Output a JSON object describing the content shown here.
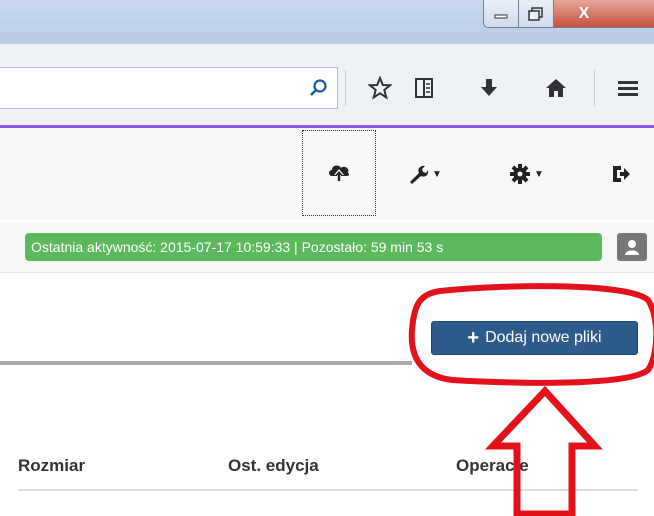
{
  "window": {
    "title_bar_buttons": [
      "minimize-button",
      "maximize-button",
      "close-button"
    ],
    "close_glyph": "X"
  },
  "browser_toolbar": {
    "icons": [
      "search-icon",
      "bookmark-star-icon",
      "reading-list-icon",
      "download-icon",
      "home-icon",
      "menu-icon"
    ]
  },
  "navbar": {
    "icons": [
      "cloud-upload-icon",
      "wrench-icon",
      "gear-icon",
      "logout-icon"
    ]
  },
  "status": {
    "text": "Ostatnia aktywność: 2015-07-17 10:59:33 | Pozostało: 59 min 53 s"
  },
  "actions": {
    "add_files_plus": "+",
    "add_files_label": "Dodaj nowe pliki"
  },
  "table": {
    "columns": [
      "Rozmiar",
      "Ost. edycja",
      "Operacje"
    ]
  },
  "annotations": {
    "highlight_color": "#e3111a",
    "arrow_color": "#e3111a"
  },
  "colors": {
    "accent": "#8a5be0",
    "status_bg": "#5cb85c",
    "button_bg": "#2e5b8a"
  }
}
